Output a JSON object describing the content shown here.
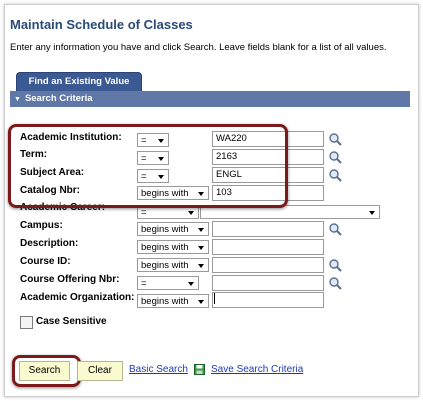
{
  "page": {
    "title": "Maintain Schedule of Classes",
    "instructions": "Enter any information you have and click Search. Leave fields blank for a list of all values."
  },
  "tab": {
    "label": "Find an Existing Value"
  },
  "section": {
    "label": "Search Criteria"
  },
  "fields": [
    {
      "label": "Academic Institution:",
      "operator": "=",
      "value": "WA220",
      "lookup_icon": "magnifier-icon"
    },
    {
      "label": "Term:",
      "operator": "=",
      "value": "2163",
      "lookup_icon": "magnifier-icon"
    },
    {
      "label": "Subject Area:",
      "operator": "=",
      "value": "ENGL",
      "lookup_icon": "magnifier-icon"
    },
    {
      "label": "Catalog Nbr:",
      "operator": "begins with",
      "value": "103"
    },
    {
      "label": "Academic Career:",
      "operator": "=",
      "value": ""
    },
    {
      "label": "Campus:",
      "operator": "begins with",
      "value": "",
      "lookup_icon": "magnifier-icon"
    },
    {
      "label": "Description:",
      "operator": "begins with",
      "value": ""
    },
    {
      "label": "Course ID:",
      "operator": "begins with",
      "value": "",
      "lookup_icon": "magnifier-icon"
    },
    {
      "label": "Course Offering Nbr:",
      "operator": "=",
      "value": "",
      "lookup_icon": "magnifier-icon"
    },
    {
      "label": "Academic Organization:",
      "operator": "begins with",
      "value": ""
    }
  ],
  "case_sensitive": {
    "label": "Case Sensitive",
    "checked": false
  },
  "actions": {
    "search": "Search",
    "clear": "Clear",
    "basic_search": "Basic Search",
    "save_search_criteria": "Save Search Criteria"
  },
  "colors": {
    "title": "#2a4a78",
    "tab": "#3b5a93",
    "section_bar": "#5f78a8",
    "highlight": "#7a1a1a",
    "button_bg": "#fafad0",
    "link": "#1e3bb5"
  }
}
